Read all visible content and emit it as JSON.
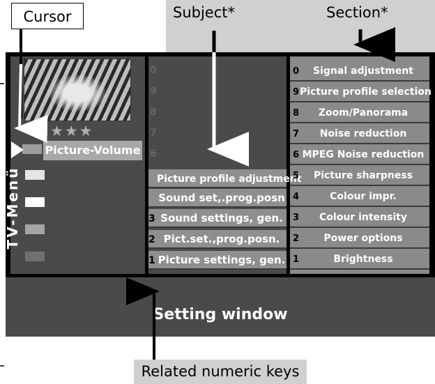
{
  "callouts": {
    "cursor": "Cursor",
    "subject": "Subject*",
    "section": "Section*",
    "related_keys": "Related numeric keys"
  },
  "menu": {
    "vertical_title": "TV-Menü",
    "stars": "★★★",
    "selected_item": "Picture-Volume"
  },
  "subjects": [
    {
      "num": "",
      "label": "Picture profile adjustment"
    },
    {
      "num": "",
      "label": "Sound set,.prog.posn"
    },
    {
      "num": "3",
      "label": "Sound settings, gen."
    },
    {
      "num": "2",
      "label": "Pict.set.,prog.posn."
    },
    {
      "num": "1",
      "label": "Picture settings, gen."
    }
  ],
  "sections": [
    {
      "num": "0",
      "label": "Signal adjustment"
    },
    {
      "num": "9",
      "label": "Picture profile selection"
    },
    {
      "num": "8",
      "label": "Zoom/Panorama"
    },
    {
      "num": "7",
      "label": "Noise reduction"
    },
    {
      "num": "6",
      "label": "MPEG Noise reduction"
    },
    {
      "num": "5",
      "label": "Picture sharpness"
    },
    {
      "num": "4",
      "label": "Colour impr."
    },
    {
      "num": "3",
      "label": "Colour intensity"
    },
    {
      "num": "2",
      "label": "Power options"
    },
    {
      "num": "1",
      "label": "Brightness"
    }
  ],
  "setting_window": "Setting window",
  "colors": {
    "panel_dark": "#4a4a4a",
    "panel_light": "#8a8a8a",
    "callout_grey": "#d0d0d0"
  }
}
